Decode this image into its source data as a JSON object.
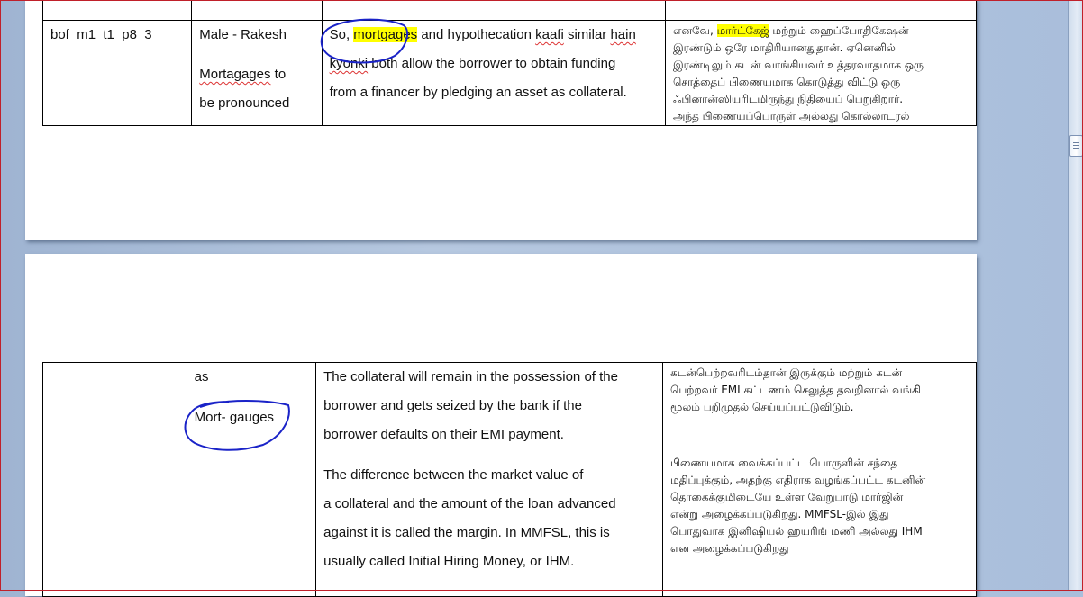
{
  "page1": {
    "row": {
      "id": "bof_m1_t1_p8_3",
      "speaker": "Male - Rakesh",
      "note_word": "Mortagages",
      "note_line1_rest": " to",
      "note_line2": "be pronounced",
      "english": {
        "pre": "So, ",
        "highlight": "mortgages",
        "l1_rest_a": "  and hypothecation ",
        "kaafi": "kaafi",
        "l1_rest_b": " similar ",
        "hain": "hain",
        "kyonki": "kyonki",
        "l2_rest": " both allow the borrower to obtain funding",
        "l3": "from a financer by pledging an asset as collateral."
      },
      "tamil": {
        "pre": "எனவே, ",
        "highlight": "மார்ட்கேஜ்",
        "l1_rest": " மற்றும் ஹைப்போதிகேஷன்",
        "lines": [
          "இரண்டும் ஒரே மாதிரியானதுதான். ஏனெனில்",
          "இரண்டிலும் கடன் வாங்கியவர் உத்தரவாதமாக ஒரு",
          "சொத்தைப் பிணையமாக கொடுத்து விட்டு ஒரு",
          "ஃபினான்ஸியரிடமிருந்து நிதியைப் பெறுகிறார்.",
          "அந்த பிணையப்பொருள் அல்லது கொல்லாடரல்"
        ]
      }
    }
  },
  "page2": {
    "row": {
      "id": "",
      "note_as": "as",
      "note_mort": "Mort- gauges",
      "english_p1": [
        "The collateral will remain in the possession of the",
        "borrower and gets seized by the bank if the",
        "borrower defaults on their EMI payment."
      ],
      "english_p2": [
        "The difference between the market value of",
        "a collateral and the amount of the loan advanced",
        "against it is called the margin. In MMFSL, this is",
        "usually called Initial Hiring Money, or IHM."
      ],
      "tamil_p1": [
        "கடன்பெற்றவரிடம்தான் இருக்கும் மற்றும் கடன்",
        "பெற்றவர் EMI கட்டணம் செலுத்த தவறினால் வங்கி",
        "மூலம் பறிமுதல் செய்யப்பட்டுவிடும்."
      ],
      "tamil_p2": [
        "பிணையமாக வைக்கப்பட்ட பொருளின் சந்தை",
        "மதிப்புக்கும், அதற்கு எதிராக வழங்கப்பட்ட கடனின்",
        "தொகைக்குமிடையே உள்ள வேறுபாடு மார்ஜின்",
        "என்று அழைக்கப்படுகிறது. MMFSL-இல் இது",
        "பொதுவாக இனிஷியல் ஹயரிங் மணி அல்லது IHM",
        "என அழைக்கப்படுகிறது"
      ]
    }
  },
  "colors": {
    "highlight": "#ffff00",
    "annotation_ink": "#1a23c8",
    "spell_squiggle": "#d33333"
  }
}
